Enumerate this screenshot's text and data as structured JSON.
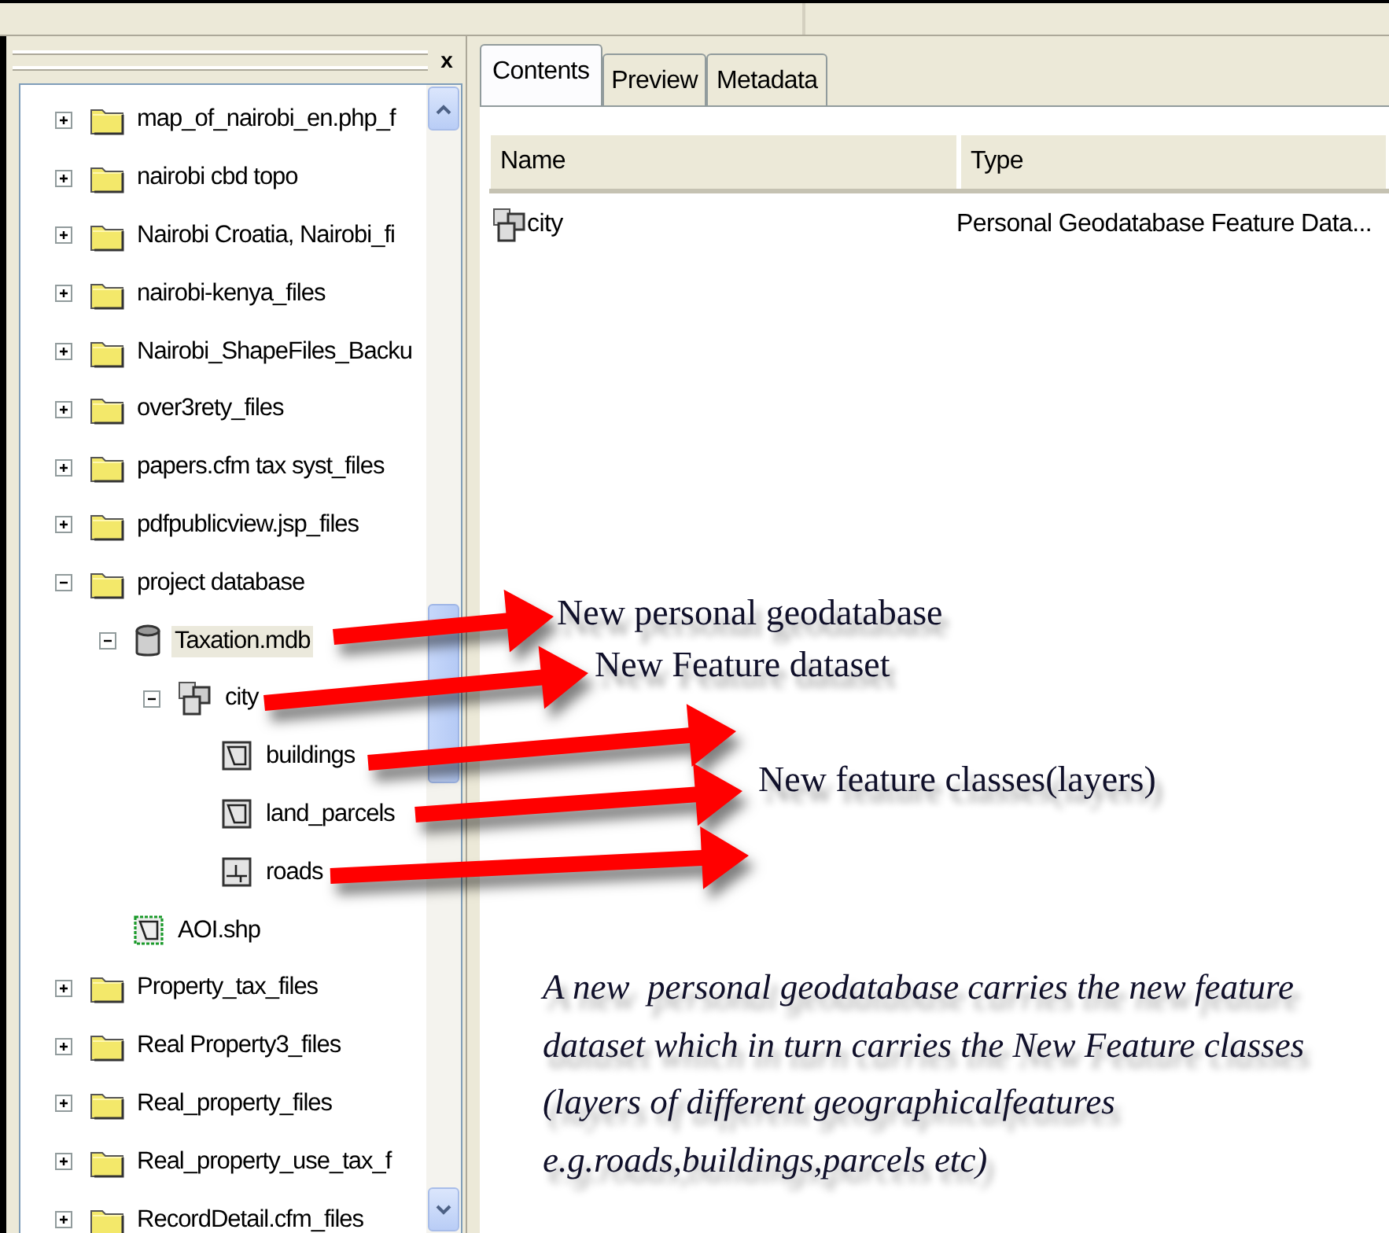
{
  "tree": [
    {
      "label": "map_of_nairobi_en.php_f",
      "kind": "folder",
      "expanded": false,
      "selected": false
    },
    {
      "label": "nairobi cbd topo",
      "kind": "folder",
      "expanded": false,
      "selected": false
    },
    {
      "label": "Nairobi Croatia, Nairobi_fi",
      "kind": "folder",
      "expanded": false,
      "selected": false
    },
    {
      "label": "nairobi-kenya_files",
      "kind": "folder",
      "expanded": false,
      "selected": false
    },
    {
      "label": "Nairobi_ShapeFiles_Backu",
      "kind": "folder",
      "expanded": false,
      "selected": false
    },
    {
      "label": "over3rety_files",
      "kind": "folder",
      "expanded": false,
      "selected": false
    },
    {
      "label": "papers.cfm tax syst_files",
      "kind": "folder",
      "expanded": false,
      "selected": false
    },
    {
      "label": "pdfpublicview.jsp_files",
      "kind": "folder",
      "expanded": false,
      "selected": false
    },
    {
      "label": "project database",
      "kind": "folder",
      "expanded": true,
      "selected": false,
      "children": [
        {
          "label": "Taxation.mdb",
          "kind": "database",
          "expanded": true,
          "selected": true,
          "children": [
            {
              "label": "city",
              "kind": "dataset",
              "expanded": true,
              "selected": false,
              "children": [
                {
                  "label": "buildings",
                  "kind": "polygon",
                  "selected": false
                },
                {
                  "label": "land_parcels",
                  "kind": "polygon",
                  "selected": false
                },
                {
                  "label": "roads",
                  "kind": "line",
                  "selected": false
                }
              ]
            }
          ]
        },
        {
          "label": "AOI.shp",
          "kind": "shapefile",
          "selected": false
        }
      ]
    },
    {
      "label": "Property_tax_files",
      "kind": "folder",
      "expanded": false,
      "selected": false
    },
    {
      "label": "Real Property3_files",
      "kind": "folder",
      "expanded": false,
      "selected": false
    },
    {
      "label": "Real_property_files",
      "kind": "folder",
      "expanded": false,
      "selected": false
    },
    {
      "label": "Real_property_use_tax_f",
      "kind": "folder",
      "expanded": false,
      "selected": false
    },
    {
      "label": "RecordDetail.cfm_files",
      "kind": "folder",
      "expanded": false,
      "selected": false
    }
  ],
  "close_button": "x",
  "tabs": [
    {
      "label": "Contents",
      "selected": true
    },
    {
      "label": "Preview",
      "selected": false
    },
    {
      "label": "Metadata",
      "selected": false
    }
  ],
  "table": {
    "columns": [
      "Name",
      "Type"
    ],
    "rows": [
      {
        "kind": "dataset",
        "name": "city",
        "type": "Personal Geodatabase Feature Data..."
      }
    ]
  },
  "callouts": [
    "New personal geodatabase",
    "New Feature dataset",
    "New feature classes(layers)"
  ],
  "note": [
    "A new  personal geodatabase carries the new feature",
    "dataset which in turn carries the New Feature classes",
    "(layers of different geographicalfeatures",
    "e.g.roads,buildings,parcels etc)"
  ]
}
